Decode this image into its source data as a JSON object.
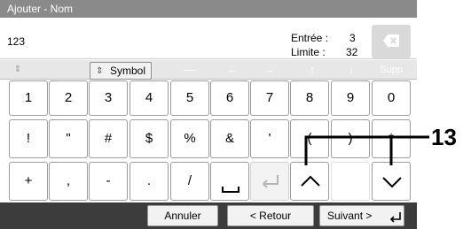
{
  "window": {
    "title": "Ajouter - Nom"
  },
  "input": {
    "value": "123"
  },
  "counter": {
    "entry_label": "Entrée :",
    "entry_value": "3",
    "limit_label": "Limite :",
    "limit_value": "32"
  },
  "toolbar": {
    "symbol_label": "Symbol",
    "del_label": "Supp"
  },
  "keys": {
    "row1": [
      "1",
      "2",
      "3",
      "4",
      "5",
      "6",
      "7",
      "8",
      "9",
      "0"
    ],
    "row2": [
      "!",
      "\"",
      "#",
      "$",
      "%",
      "&",
      "'",
      "(",
      ")",
      "*"
    ],
    "row3": [
      "+",
      ",",
      "-",
      ".",
      "/"
    ]
  },
  "footer": {
    "cancel_label": "Annuler",
    "back_label": "< Retour",
    "next_label": "Suivant >"
  },
  "annotation": {
    "number": "13"
  },
  "colors": {
    "title_bg": "#8a8a8a",
    "footer_bg": "#3c3c3c",
    "callout_line": "#000000"
  }
}
